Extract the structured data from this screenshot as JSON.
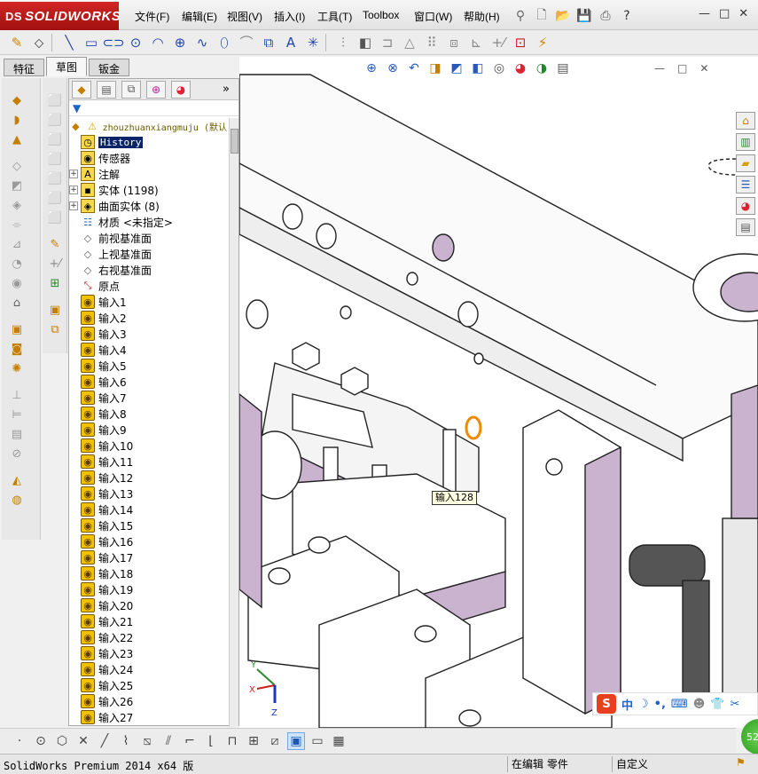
{
  "app": {
    "logo_text": "SOLIDWORKS",
    "logo_prefix": "DS"
  },
  "menu": {
    "items": [
      "文件(F)",
      "编辑(E)",
      "视图(V)",
      "插入(I)",
      "工具(T)",
      "Toolbox",
      "窗口(W)",
      "帮助(H)"
    ]
  },
  "window_controls": {
    "minimize": "—",
    "maximize": "□",
    "close": "✕"
  },
  "tabs": [
    "特征",
    "草图",
    "钣金"
  ],
  "active_tab": "草图",
  "feature_tree": {
    "root_label": "zhouzhuanxiangmuju (默认",
    "history_label": "History",
    "sensors_label": "传感器",
    "annotations_label": "注解",
    "solid_bodies_label": "实体 (1198)",
    "surface_bodies_label": "曲面实体 (8)",
    "material_label": "材质 <未指定>",
    "front_plane_label": "前视基准面",
    "top_plane_label": "上视基准面",
    "right_plane_label": "右视基准面",
    "origin_label": "原点",
    "imports": [
      "输入1",
      "输入2",
      "输入3",
      "输入4",
      "输入5",
      "输入6",
      "输入7",
      "输入8",
      "输入9",
      "输入10",
      "输入11",
      "输入12",
      "输入13",
      "输入14",
      "输入15",
      "输入16",
      "输入17",
      "输入18",
      "输入19",
      "输入20",
      "输入21",
      "输入22",
      "输入23",
      "输入24",
      "输入25",
      "输入26",
      "输入27"
    ]
  },
  "viewport": {
    "tooltip": "输入128",
    "triad": {
      "x": "X",
      "y": "Y",
      "z": "Z"
    }
  },
  "ime": {
    "logo": "S",
    "mode": "中",
    "moon": "☽",
    "dot": "•,"
  },
  "badge_text": "52",
  "status": {
    "left": "SolidWorks Premium 2014 x64 版",
    "editing": "在编辑 零件",
    "custom": "自定义"
  },
  "colors": {
    "logo_red": "#c41a1a",
    "selection_blue": "#0a246a",
    "import_icon_yellow": "#f2c200",
    "model_purple": "#c9b3cf"
  }
}
